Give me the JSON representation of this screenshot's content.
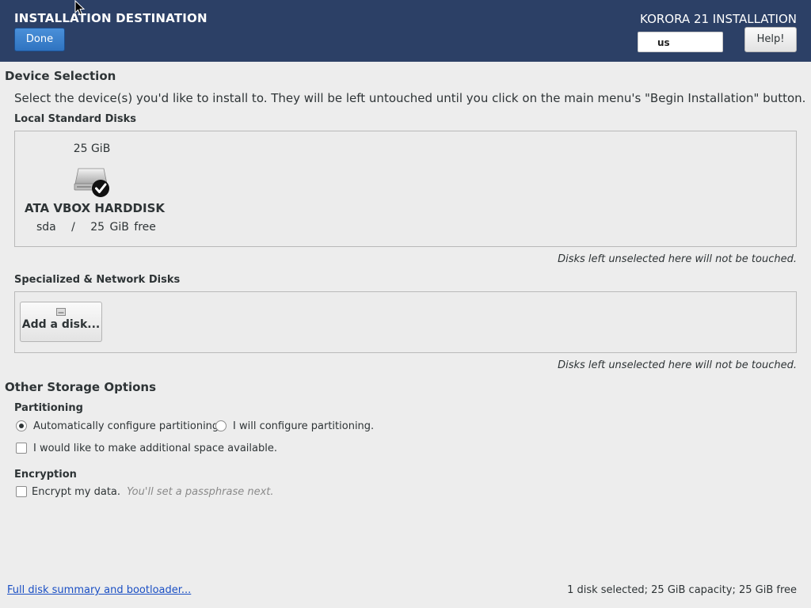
{
  "header": {
    "title": "INSTALLATION DESTINATION",
    "done_label": "Done",
    "product": "KORORA 21 INSTALLATION",
    "keyboard_layout": "us",
    "help_label": "Help!",
    "background_color": "#2c4066"
  },
  "device_selection": {
    "title": "Device Selection",
    "description": "Select the device(s) you'd like to install to.  They will be left untouched until you click on the main menu's \"Begin Installation\" button.",
    "local_disks": {
      "heading": "Local Standard Disks",
      "disks": [
        {
          "size": "25 GiB",
          "name": "ATA VBOX HARDDISK",
          "device": "sda",
          "separator": "/",
          "free": "25 GiB free",
          "selected": true,
          "icon": "harddisk-icon"
        }
      ],
      "note": "Disks left unselected here will not be touched."
    },
    "network_disks": {
      "heading": "Specialized & Network Disks",
      "add_label": "Add a disk...",
      "note": "Disks left unselected here will not be touched."
    }
  },
  "storage_options": {
    "title": "Other Storage Options",
    "partitioning": {
      "heading": "Partitioning",
      "auto_label": "Automatically configure partitioning.",
      "manual_label": "I will configure partitioning.",
      "selected": "auto",
      "space_label": "I would like to make additional space available.",
      "space_checked": false
    },
    "encryption": {
      "heading": "Encryption",
      "encrypt_label": "Encrypt my data.",
      "encrypt_hint": "You'll set a passphrase next.",
      "encrypt_checked": false
    }
  },
  "footer": {
    "link": "Full disk summary and bootloader...",
    "summary": "1 disk selected; 25 GiB capacity; 25 GiB free"
  }
}
